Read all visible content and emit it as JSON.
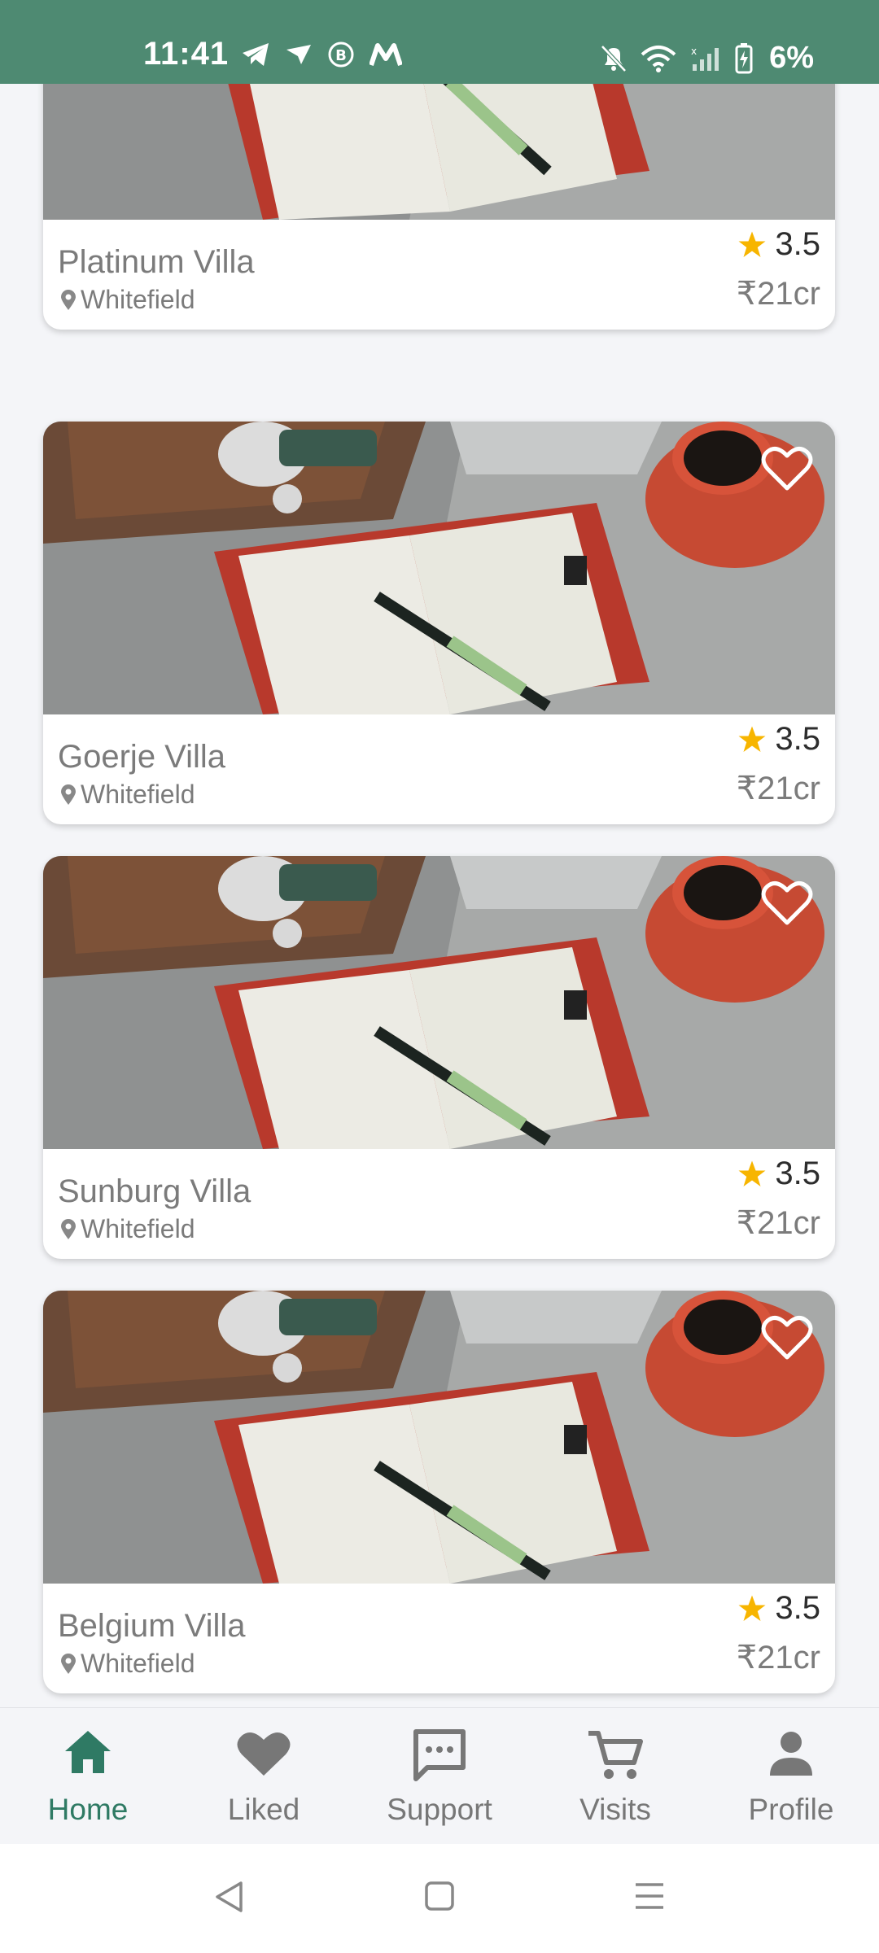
{
  "status_bar": {
    "time": "11:41",
    "battery": "6%",
    "icons": [
      "telegram-icon",
      "send-icon",
      "b-badge-icon",
      "m-logo-icon",
      "bell-off-icon",
      "wifi-icon",
      "signal-icon",
      "battery-charging-icon"
    ]
  },
  "listings": [
    {
      "name": "Platinum Villa",
      "location": "Whitefield",
      "rating": "3.5",
      "price": "₹21cr",
      "liked": false
    },
    {
      "name": "Goerje Villa",
      "location": "Whitefield",
      "rating": "3.5",
      "price": "₹21cr",
      "liked": false
    },
    {
      "name": "Sunburg Villa",
      "location": "Whitefield",
      "rating": "3.5",
      "price": "₹21cr",
      "liked": false
    },
    {
      "name": "Belgium Villa",
      "location": "Whitefield",
      "rating": "3.5",
      "price": "₹21cr",
      "liked": false
    }
  ],
  "bottom_nav": {
    "items": [
      {
        "label": "Home",
        "icon": "home-icon",
        "active": true
      },
      {
        "label": "Liked",
        "icon": "heart-icon",
        "active": false
      },
      {
        "label": "Support",
        "icon": "chat-icon",
        "active": false
      },
      {
        "label": "Visits",
        "icon": "cart-icon",
        "active": false
      },
      {
        "label": "Profile",
        "icon": "person-icon",
        "active": false
      }
    ]
  },
  "colors": {
    "brand": "#4e8a72",
    "active_nav": "#2f7a64",
    "star": "#f7b500"
  },
  "system_nav": [
    "back-icon",
    "home-square-icon",
    "menu-icon"
  ]
}
